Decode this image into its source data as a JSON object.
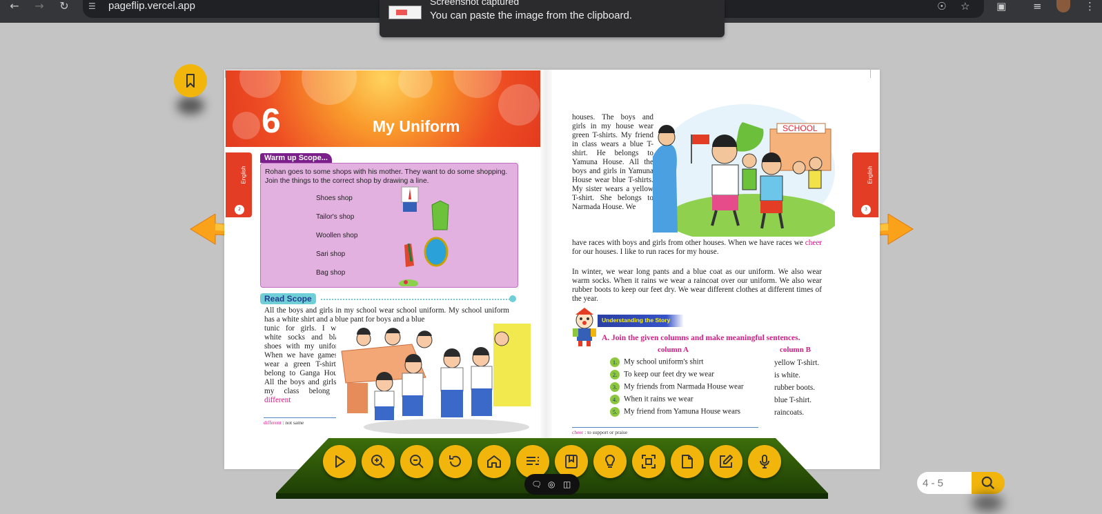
{
  "browser": {
    "url": "pageflip.vercel.app"
  },
  "toast": {
    "title": "Screenshot captured",
    "message": "You can paste the image from the clipboard."
  },
  "book": {
    "left_page": {
      "chapter_number": "6",
      "chapter_title": "My Uniform",
      "tab_label": "English",
      "page_number": "2",
      "warmup": {
        "title": "Warm up Scope...",
        "intro": "Rohan goes to some shops with his mother. They want to do some shopping. Join the things to the correct shop by drawing a line.",
        "shops": [
          "Shoes shop",
          "Tailor's shop",
          "Woollen shop",
          "Sari shop",
          "Bag shop"
        ]
      },
      "read": {
        "title": "Read Scope",
        "line1": "All the boys and girls in my school wear school uniform. My school uniform has a white shirt and a blue pant for boys and a blue",
        "narrow": "tunic for girls. I wear white socks and black shoes with my uniform. When we have games, I wear a green T-shirt. I belong to Ganga House. All the boys and girls in my class belong to",
        "highlight": "different"
      },
      "footnote_word": "different",
      "footnote_text": ": not same"
    },
    "right_page": {
      "tab_label": "English",
      "page_number": "3",
      "narrow_text": "houses. The boys and girls in my house wear green T-shirts. My friend in class wears a blue T-shirt. He belongs to Yamuna House. All the boys and girls in Yamuna House wear blue T-shirts. My sister wears a yellow T-shirt. She belongs to Narmada House. We",
      "wide_text_a": "have races with boys and girls from other houses. When we have races we",
      "wide_highlight": "cheer",
      "wide_text_b": "for our houses. I like to run races for my house.",
      "para2": "In winter, we wear long pants and a blue coat as our uniform. We also wear warm socks. When it rains we wear a raincoat over our uniform. We also wear rubber boots to keep our feet dry. We wear different clothes at different times of the year.",
      "story_title": "Understanding the Story",
      "question": "A.  Join the given columns and make meaningful sentences.",
      "col_a_head": "column A",
      "col_b_head": "column B",
      "rows": [
        {
          "n": "1.",
          "a": "My school uniform's shirt",
          "b": "yellow T-shirt."
        },
        {
          "n": "2.",
          "a": "To keep our feet dry we wear",
          "b": "is white."
        },
        {
          "n": "3.",
          "a": "My friends from Narmada House wear",
          "b": "rubber boots."
        },
        {
          "n": "4.",
          "a": "When it rains we wear",
          "b": "blue T-shirt."
        },
        {
          "n": "5.",
          "a": "My friend from Yamuna House wears",
          "b": "raincoats."
        }
      ],
      "footnote_word": "cheer",
      "footnote_text": ": to support or praise",
      "school_sign": "SCHOOL"
    }
  },
  "toolbar": {
    "icons": [
      "play-icon",
      "zoom-in-icon",
      "zoom-out-icon",
      "reset-icon",
      "home-icon",
      "table-of-contents-icon",
      "bookmarks-icon",
      "hint-icon",
      "fit-screen-icon",
      "single-page-icon",
      "notes-icon",
      "microphone-icon"
    ]
  },
  "page_search": {
    "placeholder": "4 - 5"
  },
  "colors": {
    "accent": "#f1b50c",
    "toolbar_green": "#2f5a08",
    "highlight_pink": "#e3168b"
  }
}
